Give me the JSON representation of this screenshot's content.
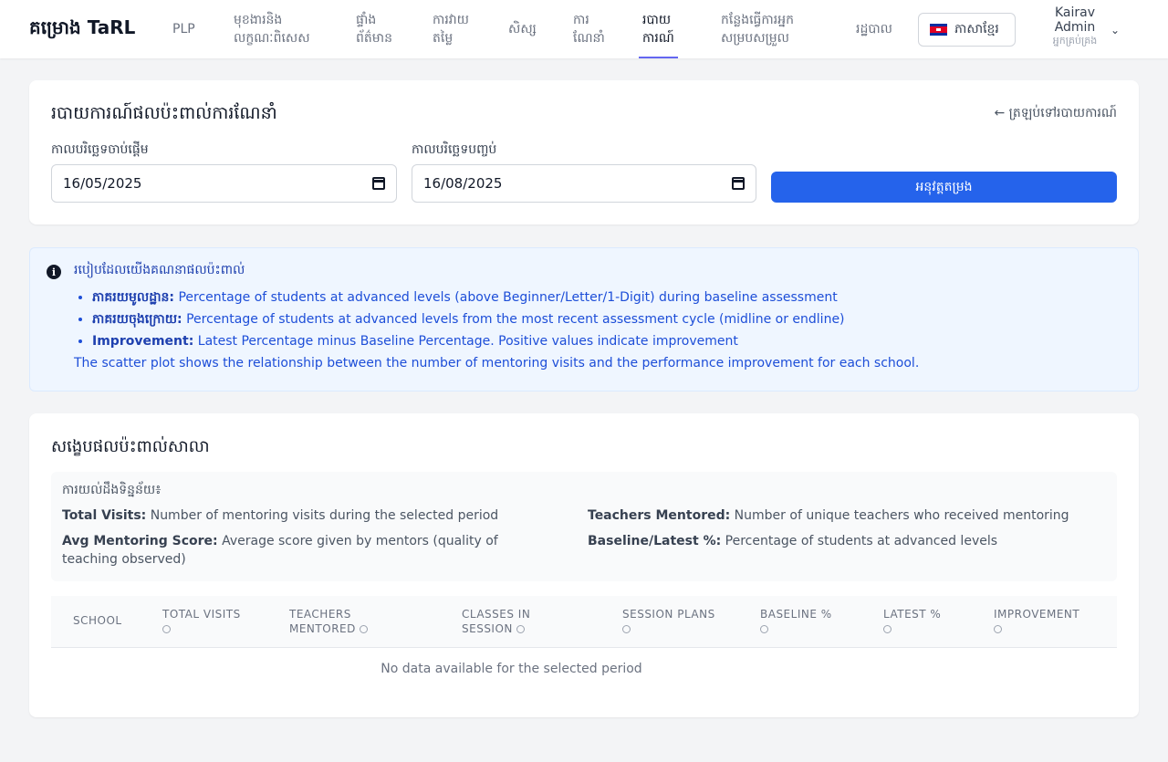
{
  "brand": "គម្រោង TaRL",
  "nav": {
    "items": [
      {
        "label": "PLP"
      },
      {
        "label": "មុខងារនិង\nលក្ខណៈពិសេស"
      },
      {
        "label": "ផ្ទាំង\nព័ត៌មាន"
      },
      {
        "label": "ការវាយ\nតម្លៃ"
      },
      {
        "label": "សិស្ស"
      },
      {
        "label": "ការ\nណែនាំ"
      },
      {
        "label": "របាយ\nការណ៍",
        "active": true
      },
      {
        "label": "កន្លែងធ្វើការអ្នក\nសម្របសម្រួល"
      },
      {
        "label": "រដ្ឋបាល"
      }
    ],
    "language": "ភាសាខ្មែរ",
    "user_name": "Kairav Admin",
    "user_role": "អ្នកគ្រប់គ្រង"
  },
  "filter": {
    "title": "របាយការណ៍ផលប៉ះពាល់ការណែនាំ",
    "back_link": "← ត្រឡប់ទៅរបាយការណ៍",
    "start_label": "កាលបរិច្ឆេទចាប់ផ្តើម",
    "start_value": "16/05/2025",
    "end_label": "កាលបរិច្ឆេទបញ្ចប់",
    "end_value": "16/08/2025",
    "apply_label": "អនុវត្តតម្រង"
  },
  "info": {
    "title": "របៀបដែលយើងគណនាផលប៉ះពាល់",
    "items": [
      {
        "term": "ភាគរយមូលដ្ឋាន:",
        "desc": " Percentage of students at advanced levels (above Beginner/Letter/1-Digit) during baseline assessment"
      },
      {
        "term": "ភាគរយចុងក្រោយ:",
        "desc": " Percentage of students at advanced levels from the most recent assessment cycle (midline or endline)"
      },
      {
        "term": "Improvement:",
        "desc": " Latest Percentage minus Baseline Percentage. Positive values indicate improvement"
      }
    ],
    "footer": "The scatter plot shows the relationship between the number of mentoring visits and the performance improvement for each school."
  },
  "summary": {
    "title": "សង្ខេបផលប៉ះពាល់សាលា",
    "defs_title": "ការយល់ដឹងទិន្នន័យ៖",
    "defs": [
      {
        "term": "Total Visits:",
        "desc": " Number of mentoring visits during the selected period"
      },
      {
        "term": "Teachers Mentored:",
        "desc": " Number of unique teachers who received mentoring"
      },
      {
        "term": "Avg Mentoring Score:",
        "desc": " Average score given by mentors (quality of teaching observed)"
      },
      {
        "term": "Baseline/Latest %:",
        "desc": " Percentage of students at advanced levels"
      }
    ],
    "columns": [
      {
        "label": "School"
      },
      {
        "label": "Total Visits"
      },
      {
        "label": "Teachers Mentored"
      },
      {
        "label": "Classes in Session"
      },
      {
        "label": "Session Plans"
      },
      {
        "label": "Baseline %"
      },
      {
        "label": "Latest %"
      },
      {
        "label": "Improvement"
      }
    ],
    "empty": "No data available for the selected period"
  }
}
